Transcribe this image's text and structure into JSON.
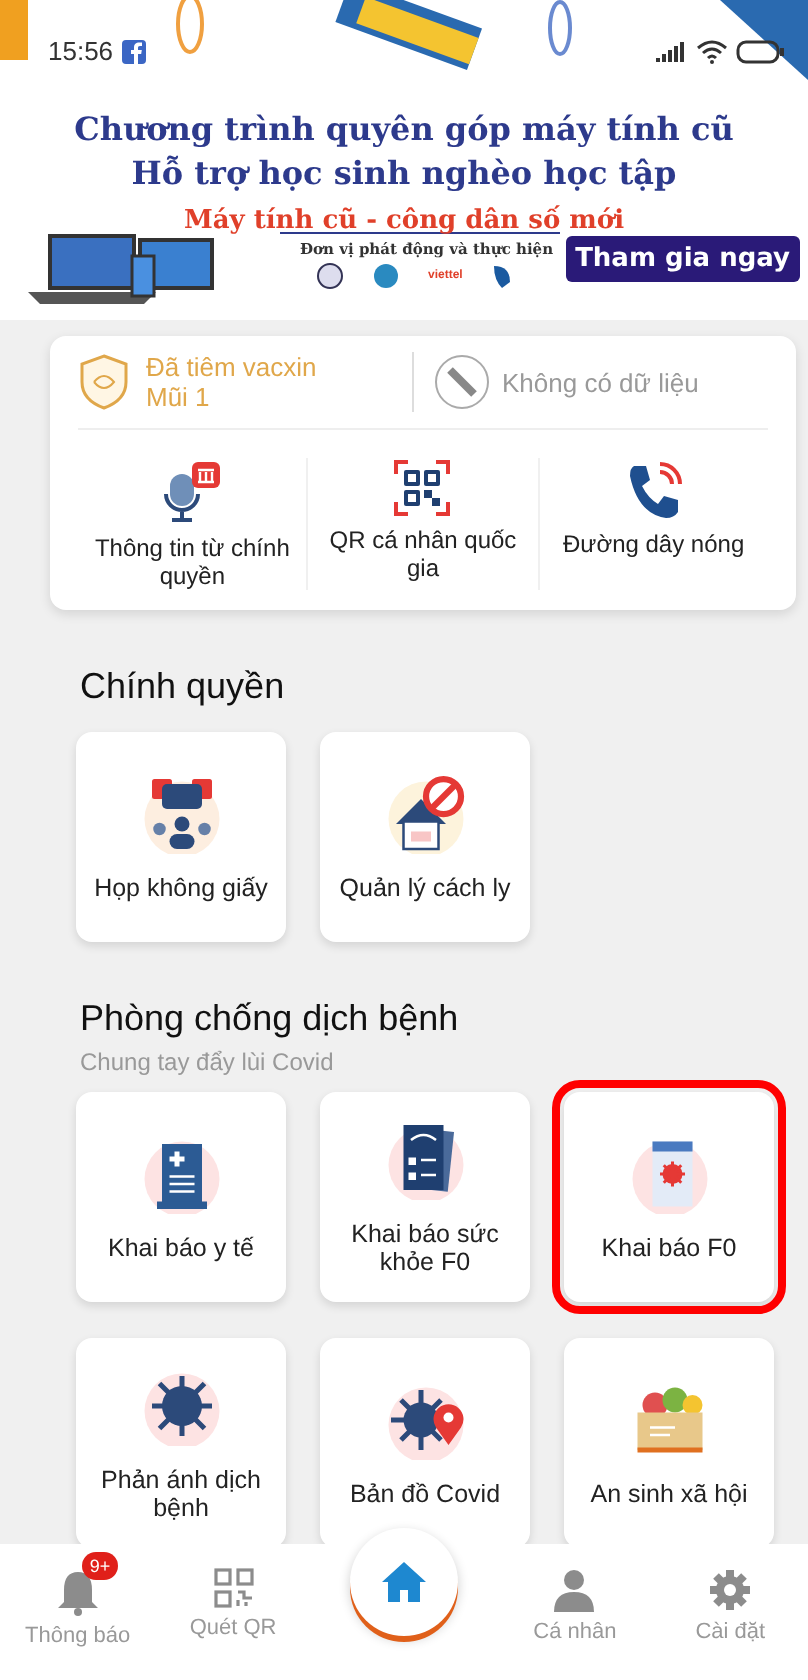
{
  "status_bar": {
    "time": "15:56"
  },
  "banner": {
    "title_lines": [
      "Chương trình quyên góp máy tính cũ",
      "Hỗ trợ học sinh nghèo học tập"
    ],
    "slogan": "Máy tính cũ - công dân số mới",
    "sponsor_caption": "Đơn vị phát động và thực hiện",
    "sponsor_logo": "viettel",
    "action": "Tham gia ngay"
  },
  "vaccine": {
    "status": "Đã tiêm vacxin",
    "dose": "Mũi 1",
    "test_result": "Không có dữ liệu"
  },
  "quick_actions": [
    {
      "kind": "info",
      "label": "Thông tin từ chính quyền"
    },
    {
      "kind": "qr",
      "label": "QR cá nhân quốc gia"
    },
    {
      "kind": "phone",
      "label": "Đường dây nóng"
    }
  ],
  "sections": [
    {
      "title": "Chính quyền",
      "items": [
        {
          "kind": "meeting",
          "label": "Họp không giấy",
          "highlighted": false
        },
        {
          "kind": "quarantine",
          "label": "Quản lý cách ly",
          "highlighted": false
        }
      ]
    },
    {
      "title": "Phòng chống dịch bệnh",
      "subtitle": "Chung tay đẩy lùi Covid",
      "items": [
        {
          "kind": "medical",
          "label": "Khai báo y tế",
          "highlighted": false
        },
        {
          "kind": "health",
          "label": "Khai báo sức khỏe F0",
          "highlighted": false
        },
        {
          "kind": "f0",
          "label": "Khai báo F0",
          "highlighted": true
        },
        {
          "kind": "virus",
          "label": "Phản ánh dịch bệnh",
          "highlighted": false
        },
        {
          "kind": "map",
          "label": "Bản đồ Covid",
          "highlighted": false
        },
        {
          "kind": "food",
          "label": "An sinh xã hội",
          "highlighted": false
        }
      ]
    }
  ],
  "bottom_nav": [
    {
      "kind": "bell",
      "label": "Thông báo",
      "badge": "9+"
    },
    {
      "kind": "qr",
      "label": "Quét QR"
    },
    {
      "kind": "person",
      "label": "Cá nhân"
    },
    {
      "kind": "gear",
      "label": "Cài đặt"
    }
  ]
}
